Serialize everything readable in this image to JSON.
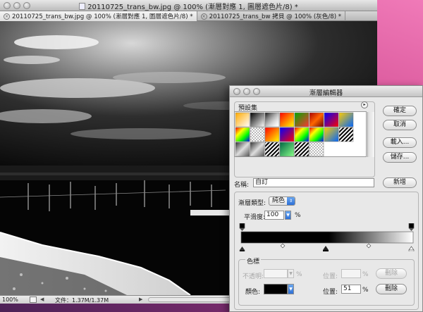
{
  "document_window": {
    "title": "20110725_trans_bw.jpg @ 100% (漸層對應 1, 圖層遮色片/8) *",
    "tabs": [
      {
        "label": "20110725_trans_bw.jpg @ 100% (漸層對應 1, 圖層遮色片/8) *",
        "active": true
      },
      {
        "label": "20110725_trans_bw 拷貝 @ 100% (灰色/8) *",
        "active": false
      }
    ],
    "status": {
      "zoom": "100%",
      "info": "文件：1.37M/1.37M"
    }
  },
  "gradient_editor": {
    "title": "漸層編輯器",
    "presets_label": "預設集",
    "buttons": {
      "ok": "確定",
      "cancel": "取消",
      "load": "載入...",
      "save": "儲存...",
      "new": "新增"
    },
    "name_label": "名稱:",
    "name_value": "自訂",
    "gradient_type_label": "漸層類型:",
    "gradient_type_value": "純色",
    "smoothness_label": "平滑度:",
    "smoothness_value": "100",
    "percent": "%",
    "stops_label": "色標",
    "opacity_label": "不透明:",
    "color_label": "顏色:",
    "location_label": "位置:",
    "location_top_value": "",
    "location_bottom_value": "51",
    "delete_label": "刪除",
    "gradient_colors": {
      "start": "#000000",
      "end": "#ffffff"
    },
    "selected_stop_color": "#000000",
    "selected_stop_location_percent": 51
  },
  "icons": [
    "close-icon",
    "window-control-icon",
    "document-icon",
    "menu-arrow-icon",
    "popup-arrow-icon",
    "color-stop-icon",
    "midpoint-icon"
  ],
  "colors": {
    "desktop": "#d9548f",
    "dialog": "#e8e8e8",
    "popup_accent": "#2d6fd6"
  }
}
